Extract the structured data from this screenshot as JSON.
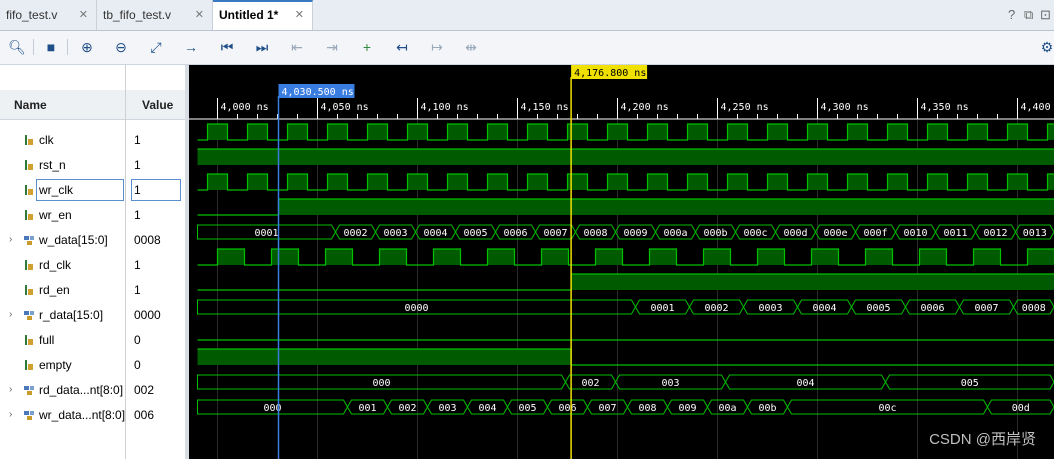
{
  "tabs": [
    {
      "label": "fifo_test.v",
      "active": false
    },
    {
      "label": "tb_fifo_test.v",
      "active": false
    },
    {
      "label": "Untitled 1*",
      "active": true
    }
  ],
  "window_controls": {
    "help": "?",
    "restore": "⧉",
    "maximize": "⊡"
  },
  "toolbar": [
    {
      "name": "search-icon",
      "glyph": "🔍︎"
    },
    {
      "name": "save-icon",
      "glyph": "■"
    },
    {
      "name": "zoom-in-icon",
      "glyph": "⊕"
    },
    {
      "name": "zoom-out-icon",
      "glyph": "⊖"
    },
    {
      "name": "zoom-fit-icon",
      "glyph": "⤢"
    },
    {
      "name": "go-to-cursor-icon",
      "glyph": "→"
    },
    {
      "name": "go-to-start-icon",
      "glyph": "⏮"
    },
    {
      "name": "go-to-end-icon",
      "glyph": "⏭"
    },
    {
      "name": "previous-transition-icon",
      "glyph": "⇤"
    },
    {
      "name": "next-transition-icon",
      "glyph": "⇥"
    },
    {
      "name": "add-marker-icon",
      "glyph": "+"
    },
    {
      "name": "previous-marker-icon",
      "glyph": "↤"
    },
    {
      "name": "next-marker-icon",
      "glyph": "↦"
    },
    {
      "name": "swap-cursors-icon",
      "glyph": "⇹"
    }
  ],
  "columns": {
    "name": "Name",
    "value": "Value"
  },
  "signals": [
    {
      "name": "clk",
      "value": "1",
      "type": "bit",
      "expandable": false
    },
    {
      "name": "rst_n",
      "value": "1",
      "type": "bit",
      "expandable": false
    },
    {
      "name": "wr_clk",
      "value": "1",
      "type": "bit",
      "expandable": false,
      "selected": true
    },
    {
      "name": "wr_en",
      "value": "1",
      "type": "bit",
      "expandable": false
    },
    {
      "name": "w_data[15:0]",
      "value": "0008",
      "type": "bus",
      "expandable": true
    },
    {
      "name": "rd_clk",
      "value": "1",
      "type": "bit",
      "expandable": false
    },
    {
      "name": "rd_en",
      "value": "1",
      "type": "bit",
      "expandable": false
    },
    {
      "name": "r_data[15:0]",
      "value": "0000",
      "type": "bus",
      "expandable": true
    },
    {
      "name": "full",
      "value": "0",
      "type": "bit",
      "expandable": false
    },
    {
      "name": "empty",
      "value": "0",
      "type": "bit",
      "expandable": false
    },
    {
      "name": "rd_data...nt[8:0]",
      "value": "002",
      "type": "bus",
      "expandable": true
    },
    {
      "name": "wr_data...nt[8:0]",
      "value": "006",
      "type": "bus",
      "expandable": true
    }
  ],
  "timeline": {
    "labels": [
      "4,000 ns",
      "4,050 ns",
      "4,100 ns",
      "4,150 ns",
      "4,200 ns",
      "4,250 ns",
      "4,300 ns",
      "4,350 ns",
      "4,400"
    ],
    "cursor_blue": {
      "label": "4,030.500 ns",
      "time": 4030.5
    },
    "cursor_yellow": {
      "label": "4,176.800 ns",
      "time": 4176.8
    }
  },
  "buses": {
    "w_data": [
      {
        "label": "0001",
        "start": 3983,
        "end": 4059
      },
      {
        "label": "0002",
        "start": 4059,
        "end": 4079
      },
      {
        "label": "0003",
        "start": 4079,
        "end": 4099
      },
      {
        "label": "0004",
        "start": 4099,
        "end": 4119
      },
      {
        "label": "0005",
        "start": 4119,
        "end": 4139
      },
      {
        "label": "0006",
        "start": 4139,
        "end": 4159
      },
      {
        "label": "0007",
        "start": 4159,
        "end": 4179
      },
      {
        "label": "0008",
        "start": 4179,
        "end": 4199
      },
      {
        "label": "0009",
        "start": 4199,
        "end": 4219
      },
      {
        "label": "000a",
        "start": 4219,
        "end": 4239
      },
      {
        "label": "000b",
        "start": 4239,
        "end": 4259
      },
      {
        "label": "000c",
        "start": 4259,
        "end": 4279
      },
      {
        "label": "000d",
        "start": 4279,
        "end": 4299
      },
      {
        "label": "000e",
        "start": 4299,
        "end": 4319
      },
      {
        "label": "000f",
        "start": 4319,
        "end": 4339
      },
      {
        "label": "0010",
        "start": 4339,
        "end": 4359
      },
      {
        "label": "0011",
        "start": 4359,
        "end": 4379
      },
      {
        "label": "0012",
        "start": 4379,
        "end": 4399
      },
      {
        "label": "0013",
        "start": 4399,
        "end": 4419
      }
    ],
    "r_data": [
      {
        "label": "0000",
        "start": 3983,
        "end": 4209
      },
      {
        "label": "0001",
        "start": 4209,
        "end": 4236
      },
      {
        "label": "0002",
        "start": 4236,
        "end": 4263
      },
      {
        "label": "0003",
        "start": 4263,
        "end": 4290
      },
      {
        "label": "0004",
        "start": 4290,
        "end": 4317
      },
      {
        "label": "0005",
        "start": 4317,
        "end": 4344
      },
      {
        "label": "0006",
        "start": 4344,
        "end": 4371
      },
      {
        "label": "0007",
        "start": 4371,
        "end": 4398
      },
      {
        "label": "0008",
        "start": 4398,
        "end": 4425
      }
    ],
    "rd_count": [
      {
        "label": "000",
        "start": 3983,
        "end": 4174
      },
      {
        "label": "002",
        "start": 4174,
        "end": 4199
      },
      {
        "label": "003",
        "start": 4199,
        "end": 4254
      },
      {
        "label": "004",
        "start": 4254,
        "end": 4334
      },
      {
        "label": "005",
        "start": 4334,
        "end": 4425
      }
    ],
    "wr_count": [
      {
        "label": "000",
        "start": 3983,
        "end": 4065
      },
      {
        "label": "001",
        "start": 4065,
        "end": 4085
      },
      {
        "label": "002",
        "start": 4085,
        "end": 4105
      },
      {
        "label": "003",
        "start": 4105,
        "end": 4125
      },
      {
        "label": "004",
        "start": 4125,
        "end": 4145
      },
      {
        "label": "005",
        "start": 4145,
        "end": 4165
      },
      {
        "label": "006",
        "start": 4165,
        "end": 4185
      },
      {
        "label": "007",
        "start": 4185,
        "end": 4205
      },
      {
        "label": "008",
        "start": 4205,
        "end": 4225
      },
      {
        "label": "009",
        "start": 4225,
        "end": 4245
      },
      {
        "label": "00a",
        "start": 4245,
        "end": 4265
      },
      {
        "label": "00b",
        "start": 4265,
        "end": 4285
      },
      {
        "label": "00c",
        "start": 4285,
        "end": 4385
      },
      {
        "label": "00d",
        "start": 4385,
        "end": 4425
      }
    ]
  },
  "watermark": "CSDN @西岸贤"
}
